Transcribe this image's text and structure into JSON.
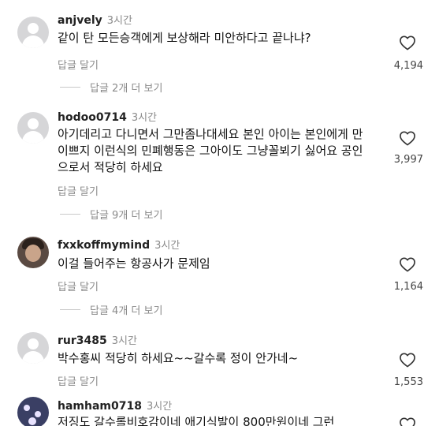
{
  "comments": [
    {
      "username": "anjvely",
      "time": "3시간",
      "text": "같이 탄 모든승객에게 보상해라 미안하다고 끝나냐?",
      "reply_label": "답글 달기",
      "likes": "4,194",
      "more_replies": "답글 2개 더 보기",
      "avatar": "default-avatar-icon"
    },
    {
      "username": "hodoo0714",
      "time": "3시간",
      "text": "아기데리고 다니면서 그만좀나대세요 본인 아이는 본인에게 만 이쁘지 이런식의 민폐행동은 그아이도 그냥꼴뵈기 싫어요 공인으로서 적당히 하세요",
      "reply_label": "답글 달기",
      "likes": "3,997",
      "more_replies": "답글 9개 더 보기",
      "avatar": "default-avatar-icon"
    },
    {
      "username": "fxxkoffmymind",
      "time": "3시간",
      "text": "이걸 들어주는 항공사가 문제임",
      "reply_label": "답글 달기",
      "likes": "1,164",
      "more_replies": "답글 4개 더 보기",
      "avatar": "photo-avatar"
    },
    {
      "username": "rur3485",
      "time": "3시간",
      "text": "박수홍씨 적당히  하세요~~갈수록  정이  안가네~",
      "reply_label": "답글 달기",
      "likes": "1,553",
      "avatar": "default-avatar-icon"
    },
    {
      "username": "hamham0718",
      "time": "3시간",
      "text": "저징도 갈수롤비호감이네 애기식발이 800만원이네 그런",
      "avatar": "scene-avatar"
    }
  ],
  "icons": {
    "like": "heart-outline-icon"
  },
  "colors": {
    "muted": "#8a8a8a",
    "text": "#111111",
    "avatar_bg": "#d6d6d8"
  }
}
